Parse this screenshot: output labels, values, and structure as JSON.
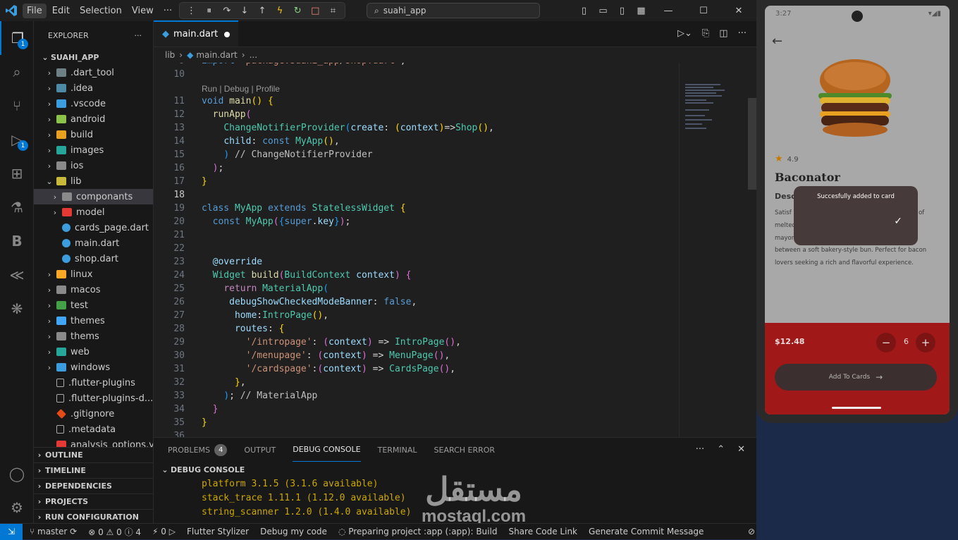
{
  "titlebar": {
    "menus": [
      "File",
      "Edit",
      "Selection",
      "View",
      "···"
    ],
    "search": "suahi_app"
  },
  "explorer": {
    "title": "EXPLORER",
    "root": "SUAHI_APP",
    "items": [
      {
        "label": ".dart_tool",
        "type": "folder",
        "indent": 1,
        "open": false
      },
      {
        "label": ".idea",
        "type": "folder",
        "indent": 1,
        "open": false
      },
      {
        "label": ".vscode",
        "type": "folder",
        "indent": 1,
        "open": false
      },
      {
        "label": "android",
        "type": "folder",
        "indent": 1,
        "open": false
      },
      {
        "label": "build",
        "type": "folder",
        "indent": 1,
        "open": false
      },
      {
        "label": "images",
        "type": "folder",
        "indent": 1,
        "open": false
      },
      {
        "label": "ios",
        "type": "folder",
        "indent": 1,
        "open": false
      },
      {
        "label": "lib",
        "type": "folder",
        "indent": 1,
        "open": true
      },
      {
        "label": "componants",
        "type": "folder",
        "indent": 2,
        "open": false,
        "selected": true
      },
      {
        "label": "model",
        "type": "folder",
        "indent": 2,
        "open": false
      },
      {
        "label": "cards_page.dart",
        "type": "dart",
        "indent": 2
      },
      {
        "label": "main.dart",
        "type": "dart",
        "indent": 2
      },
      {
        "label": "shop.dart",
        "type": "dart",
        "indent": 2
      },
      {
        "label": "linux",
        "type": "folder",
        "indent": 1,
        "open": false
      },
      {
        "label": "macos",
        "type": "folder",
        "indent": 1,
        "open": false
      },
      {
        "label": "test",
        "type": "folder",
        "indent": 1,
        "open": false
      },
      {
        "label": "themes",
        "type": "folder",
        "indent": 1,
        "open": false
      },
      {
        "label": "thems",
        "type": "folder",
        "indent": 1,
        "open": false
      },
      {
        "label": "web",
        "type": "folder",
        "indent": 1,
        "open": false
      },
      {
        "label": "windows",
        "type": "folder",
        "indent": 1,
        "open": false
      },
      {
        "label": ".flutter-plugins",
        "type": "file",
        "indent": 1
      },
      {
        "label": ".flutter-plugins-d...",
        "type": "file",
        "indent": 1
      },
      {
        "label": ".gitignore",
        "type": "git",
        "indent": 1
      },
      {
        "label": ".metadata",
        "type": "file",
        "indent": 1
      },
      {
        "label": "analysis_options.y...",
        "type": "yaml",
        "indent": 1
      }
    ],
    "sections": [
      "OUTLINE",
      "TIMELINE",
      "DEPENDENCIES",
      "PROJECTS",
      "RUN CONFIGURATION"
    ]
  },
  "editor": {
    "tab": "main.dart",
    "breadcrumb": [
      "lib",
      "main.dart",
      "..."
    ],
    "codelens": "Run | Debug | Profile",
    "lines": [
      {
        "n": "9",
        "h": "<span class='kw'>import</span> <span class='str'>'package:suahi_app/shop.dart'</span>;"
      },
      {
        "n": "10",
        "h": ""
      },
      {
        "n": "11",
        "h": "<span class='kw'>void</span> <span class='fn'>main</span><span class='br1'>()</span> <span class='br1'>{</span>"
      },
      {
        "n": "12",
        "h": "  <span class='fn'>runApp</span><span class='br2'>(</span>"
      },
      {
        "n": "13",
        "h": "    <span class='cls'>ChangeNotifierProvider</span><span class='br3'>(</span><span class='var'>create</span>: <span class='br1'>(</span><span class='var'>context</span><span class='br1'>)</span>=><span class='cls'>Shop</span><span class='br1'>()</span>,"
      },
      {
        "n": "14",
        "h": "    <span class='var'>child</span>: <span class='kw'>const</span> <span class='cls'>MyApp</span><span class='br1'>()</span>,"
      },
      {
        "n": "15",
        "h": "    <span class='br3'>)</span> <span class='cmt'>// ChangeNotifierProvider</span>"
      },
      {
        "n": "16",
        "h": "  <span class='br2'>)</span>;"
      },
      {
        "n": "17",
        "h": "<span class='br1'>}</span>"
      },
      {
        "n": "18",
        "h": ""
      },
      {
        "n": "19",
        "h": "<span class='kw'>class</span> <span class='cls'>MyApp</span> <span class='kw'>extends</span> <span class='cls'>StatelessWidget</span> <span class='br1'>{</span>"
      },
      {
        "n": "20",
        "h": "  <span class='kw'>const</span> <span class='cls'>MyApp</span><span class='br2'>(</span><span class='br3'>{</span><span class='kw'>super</span>.<span class='var'>key</span><span class='br3'>}</span><span class='br2'>)</span>;"
      },
      {
        "n": "21",
        "h": ""
      },
      {
        "n": "22",
        "h": ""
      },
      {
        "n": "23",
        "h": "  <span class='ann'>@override</span>"
      },
      {
        "n": "24",
        "h": "  <span class='cls'>Widget</span> <span class='fn'>build</span><span class='br2'>(</span><span class='cls'>BuildContext</span> <span class='var'>context</span><span class='br2'>)</span> <span class='br2'>{</span>"
      },
      {
        "n": "25",
        "h": "    <span class='kw2'>return</span> <span class='cls'>MaterialApp</span><span class='br3'>(</span>"
      },
      {
        "n": "26",
        "h": "     <span class='var'>debugShowCheckedModeBanner</span>: <span class='kw'>false</span>,"
      },
      {
        "n": "27",
        "h": "      <span class='var'>home</span>:<span class='cls'>IntroPage</span><span class='br1'>()</span>,"
      },
      {
        "n": "28",
        "h": "      <span class='var'>routes</span>: <span class='br1'>{</span>"
      },
      {
        "n": "29",
        "h": "        <span class='str'>'/intropage'</span>: <span class='br2'>(</span><span class='var'>context</span><span class='br2'>)</span> => <span class='cls'>IntroPage</span><span class='br2'>()</span>,"
      },
      {
        "n": "30",
        "h": "        <span class='str'>'/menupage'</span>: <span class='br2'>(</span><span class='var'>context</span><span class='br2'>)</span> => <span class='cls'>MenuPage</span><span class='br2'>()</span>,"
      },
      {
        "n": "31",
        "h": "        <span class='str'>'/cardspage'</span>:<span class='br2'>(</span><span class='var'>context</span><span class='br2'>)</span> => <span class='cls'>CardsPage</span><span class='br2'>()</span>,"
      },
      {
        "n": "32",
        "h": "      <span class='br1'>}</span>,"
      },
      {
        "n": "33",
        "h": "    <span class='br3'>)</span>; <span class='cmt'>// MaterialApp</span>"
      },
      {
        "n": "34",
        "h": "  <span class='br2'>}</span>"
      },
      {
        "n": "35",
        "h": "<span class='br1'>}</span>"
      },
      {
        "n": "36",
        "h": ""
      }
    ]
  },
  "panel": {
    "tabs": [
      "PROBLEMS",
      "OUTPUT",
      "DEBUG CONSOLE",
      "TERMINAL",
      "SEARCH ERROR"
    ],
    "problems_count": "4",
    "active": "DEBUG CONSOLE",
    "section": "DEBUG CONSOLE",
    "lines": [
      "platform 3.1.5 (3.1.6 available)",
      "stack_trace 1.11.1 (1.12.0 available)",
      "string_scanner 1.2.0 (1.4.0 available)"
    ]
  },
  "statusbar": {
    "branch": "master",
    "errors": "0",
    "warnings": "0",
    "info": "4",
    "ports": "0",
    "items": [
      "Flutter Stylizer",
      "Debug my code",
      "Preparing project :app (:app): Build",
      "Share Code Link",
      "Generate Commit Message"
    ]
  },
  "watermark": {
    "arabic": "مستقل",
    "latin": "mostaql.com"
  },
  "phone": {
    "time": "3:27",
    "rating": "4.9",
    "title": "Baconator",
    "desc_heading": "Desc",
    "description": "Satisf                                                      burger featur                                                      red with s                                                      n, and two slices of melted American cheese. Topped with creamy mayonnaise and tangy ketchup, all sandwiched between a soft bakery-style bun. Perfect for bacon lovers seeking a rich and flavorful experience.",
    "toast": "Succesfully added to card",
    "price": "$12.48",
    "quantity": "6",
    "cart_button": "Add To Cards"
  },
  "colors": {
    "accent": "#0078d4",
    "phone_bottom": "#a01818",
    "toast": "#473a3b"
  }
}
